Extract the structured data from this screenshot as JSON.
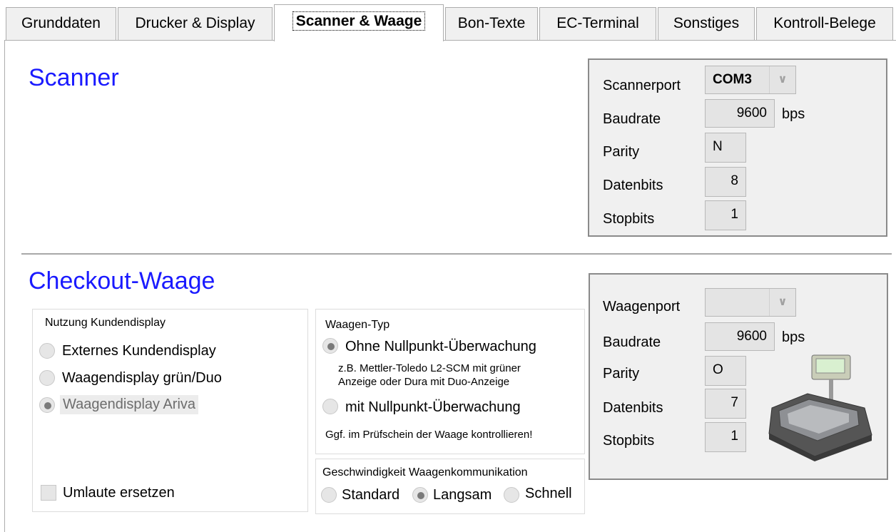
{
  "tabs": [
    {
      "label": "Grunddaten"
    },
    {
      "label": "Drucker & Display"
    },
    {
      "label": "Scanner & Waage"
    },
    {
      "label": "Bon-Texte"
    },
    {
      "label": "EC-Terminal"
    },
    {
      "label": "Sonstiges"
    },
    {
      "label": "Kontroll-Belege"
    }
  ],
  "scanner": {
    "title": "Scanner",
    "port_label": "Scannerport",
    "port_value": "COM3",
    "baud_label": "Baudrate",
    "baud_value": "9600",
    "baud_unit": "bps",
    "parity_label": "Parity",
    "parity_value": "N",
    "databits_label": "Datenbits",
    "databits_value": "8",
    "stopbits_label": "Stopbits",
    "stopbits_value": "1"
  },
  "scale": {
    "title": "Checkout-Waage",
    "display_group": {
      "title": "Nutzung Kundendisplay",
      "options": [
        "Externes Kundendisplay",
        "Waagendisplay grün/Duo",
        "Waagendisplay Ariva"
      ],
      "selected": 2,
      "replace_umlauts_label": "Umlaute ersetzen",
      "replace_umlauts_checked": false
    },
    "type_group": {
      "title": "Waagen-Typ",
      "option1": "Ohne Nullpunkt-Überwachung",
      "option1_note_line1": "z.B. Mettler-Toledo L2-SCM mit grüner",
      "option1_note_line2": "Anzeige oder Dura mit Duo-Anzeige",
      "option2": "mit Nullpunkt-Überwachung",
      "hint": "Ggf. im Prüfschein der Waage kontrollieren!",
      "selected": 0
    },
    "speed_group": {
      "title": "Geschwindigkeit Waagenkommunikation",
      "options": [
        "Standard",
        "Langsam",
        "Schnell"
      ],
      "selected": 1
    },
    "port_label": "Waagenport",
    "port_value": "",
    "baud_label": "Baudrate",
    "baud_value": "9600",
    "baud_unit": "bps",
    "parity_label": "Parity",
    "parity_value": "O",
    "databits_label": "Datenbits",
    "databits_value": "7",
    "stopbits_label": "Stopbits",
    "stopbits_value": "1"
  }
}
